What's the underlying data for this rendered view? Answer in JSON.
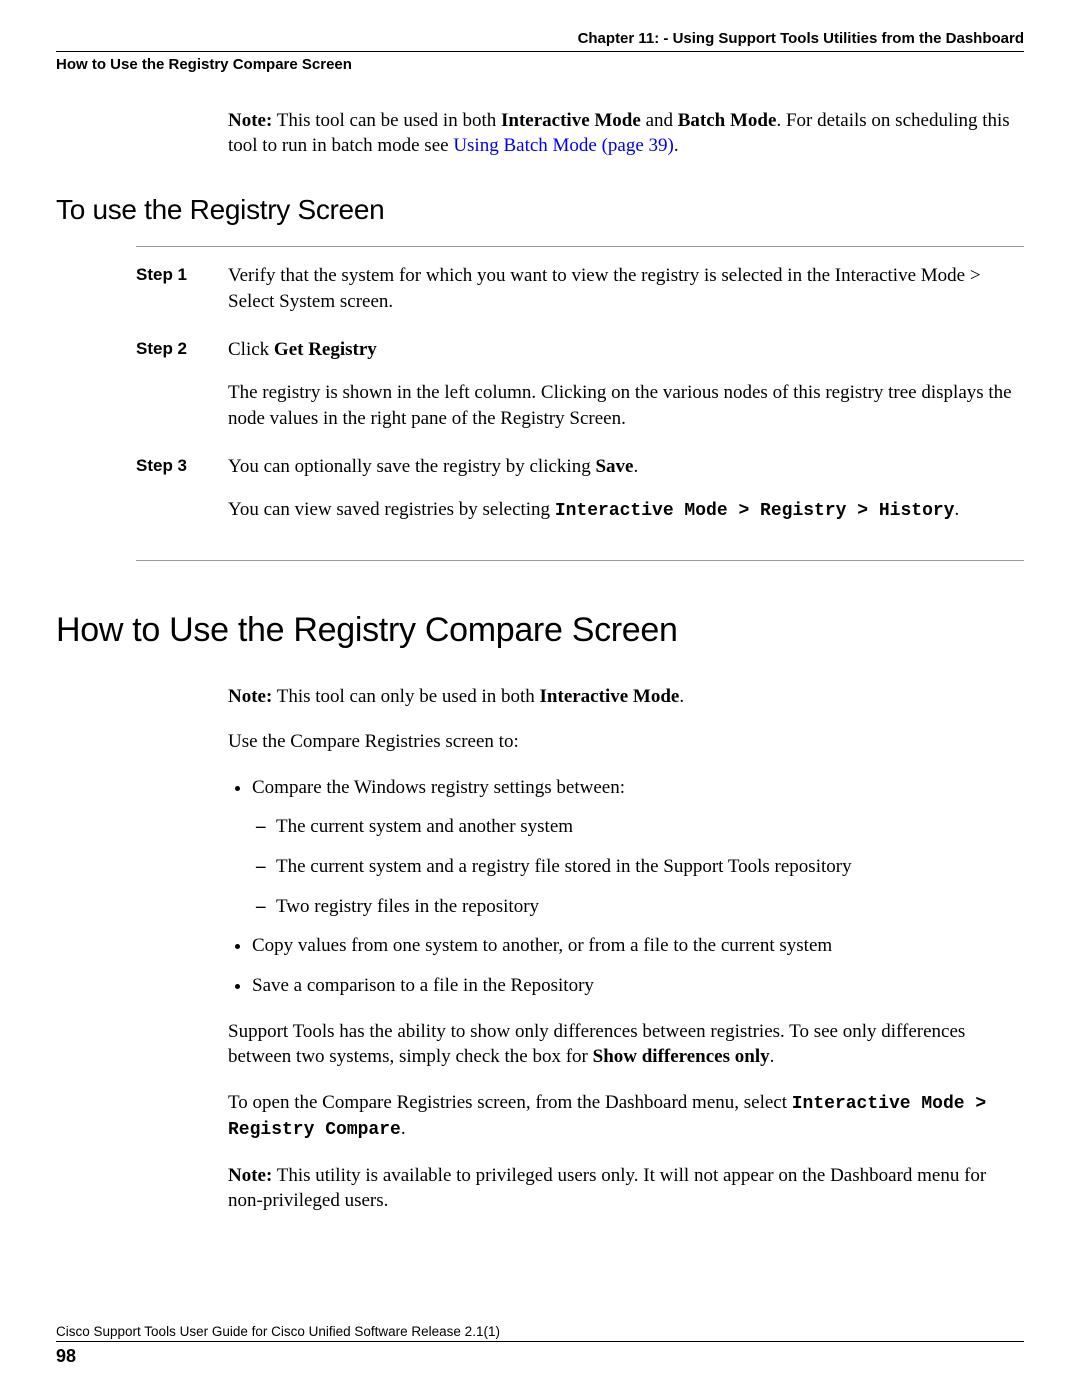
{
  "header": {
    "chapter": "Chapter 11: - Using Support Tools Utilities from the Dashboard",
    "section": "How to Use the Registry Compare Screen"
  },
  "note1": {
    "label": "Note:",
    "prefix": " This tool can be used in both ",
    "bold1": "Interactive Mode",
    "mid": " and ",
    "bold2": "Batch Mode",
    "after": ". For details on scheduling this tool to run in batch mode see ",
    "link_text": "Using Batch Mode (page 39)",
    "link_suffix": "."
  },
  "h2_text": "To use the Registry Screen",
  "steps": {
    "s1label": "Step 1",
    "s1text": "Verify that the system for which you want to view the registry is selected in the Interactive Mode > Select System screen.",
    "s2label": "Step 2",
    "s2pre": "Click ",
    "s2bold": "Get Registry",
    "s2para": "The registry is shown in the left column. Clicking on the various nodes of this registry tree displays the node values in the right pane of the Registry Screen.",
    "s3label": "Step 3",
    "s3pre": "You can optionally save the registry by clicking ",
    "s3bold": "Save",
    "s3suf": ".",
    "s3para_pre": "You can view saved registries by selecting ",
    "s3mono": "Interactive Mode > Registry > History",
    "s3para_suf": "."
  },
  "h1_text": "How to Use the Registry Compare Screen",
  "note2": {
    "label": "Note:",
    "pre": " This tool can only be used in both ",
    "bold": "Interactive Mode",
    "suf": "."
  },
  "body": {
    "intro": "Use the Compare Registries screen to:",
    "bullet1": "Compare the Windows registry settings between:",
    "dash1": "The current system and another system",
    "dash2": "The current system and a registry file stored in the Support Tools repository",
    "dash3": "Two registry files in the repository",
    "bullet2": "Copy values from one system to another, or from a file to the current system",
    "bullet3": "Save a comparison to a file in the Repository",
    "diff_pre": "Support Tools has the ability to show only differences between registries. To see only differences between two systems, simply check the box for ",
    "diff_bold": "Show differences only",
    "diff_suf": ".",
    "open_pre": "To open the Compare Registries screen, from the Dashboard menu, select ",
    "open_mono": "Interactive Mode > Registry Compare",
    "open_suf": ".",
    "note3_label": "Note:",
    "note3_text": " This utility is available to privileged users only. It will not appear on the Dashboard menu for non-privileged users."
  },
  "footer": {
    "title": "Cisco Support Tools User Guide for Cisco Unified Software Release 2.1(1)",
    "page": "98"
  }
}
